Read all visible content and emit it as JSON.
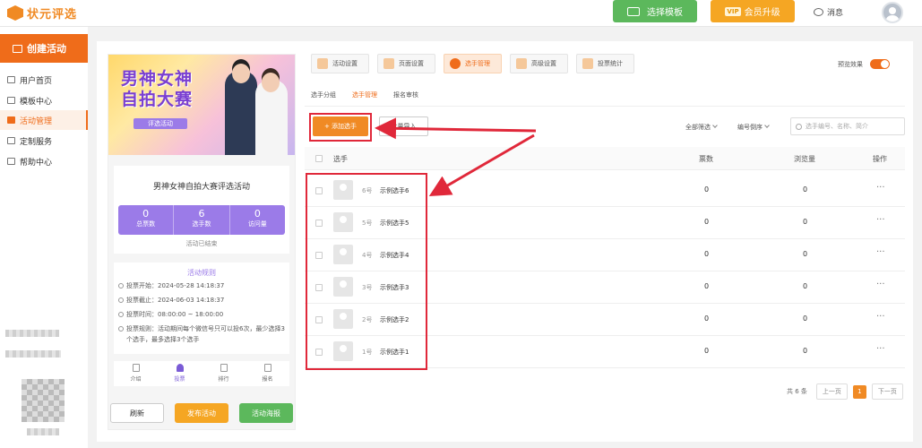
{
  "header": {
    "logo_text": "状元评选",
    "template_button": "选择模板",
    "vip_badge": "VIP",
    "vip_button": "会员升级",
    "messages": "消息"
  },
  "sidebar": {
    "create_button": "创建活动",
    "items": [
      {
        "label": "用户首页"
      },
      {
        "label": "模板中心"
      },
      {
        "label": "活动管理"
      },
      {
        "label": "定制服务"
      },
      {
        "label": "帮助中心"
      }
    ],
    "active_item": "活动管理"
  },
  "preview": {
    "banner_title_line1": "男神女神",
    "banner_title_line2": "自拍大赛",
    "banner_tag": "评选活动",
    "activity_title": "男神女神自拍大赛评选活动",
    "stats": [
      {
        "value": "0",
        "label": "总票数"
      },
      {
        "value": "6",
        "label": "选手数"
      },
      {
        "value": "0",
        "label": "访问量"
      }
    ],
    "status": "活动已结束",
    "rules_title": "活动规则",
    "rules": [
      "投票开始：2024-05-28 14:18:37",
      "投票截止：2024-06-03 14:18:37",
      "投票时间：08:00:00 ~ 18:00:00",
      "投票规则：活动期间每个微信号只可以投6次，最少选择3个选手，最多选择3个选手"
    ],
    "tabbar": [
      {
        "label": "介绍"
      },
      {
        "label": "投票"
      },
      {
        "label": "排行"
      },
      {
        "label": "报名"
      }
    ],
    "buttons": {
      "refresh": "刷新",
      "publish": "发布活动",
      "poster": "活动海报"
    }
  },
  "tabs": [
    {
      "label": "活动设置"
    },
    {
      "label": "页面设置"
    },
    {
      "label": "选手管理"
    },
    {
      "label": "高级设置"
    },
    {
      "label": "投票统计"
    }
  ],
  "active_tab": "选手管理",
  "preview_toggle_label": "预览效果",
  "subtabs": [
    {
      "label": "选手分组"
    },
    {
      "label": "选手管理"
    },
    {
      "label": "报名审核"
    }
  ],
  "toolbar": {
    "add_button": "+ 添加选手",
    "import_button": "批量导入",
    "filter_all": "全部筛选",
    "sort": "编号倒序",
    "search_placeholder": "选手编号、名称、简介"
  },
  "table": {
    "headers": {
      "contestant": "选手",
      "votes": "票数",
      "views": "浏览量",
      "actions": "操作"
    },
    "rows": [
      {
        "num": "6号",
        "name": "示例选手6",
        "votes": "0",
        "views": "0",
        "more": "···"
      },
      {
        "num": "5号",
        "name": "示例选手5",
        "votes": "0",
        "views": "0",
        "more": "···"
      },
      {
        "num": "4号",
        "name": "示例选手4",
        "votes": "0",
        "views": "0",
        "more": "···"
      },
      {
        "num": "3号",
        "name": "示例选手3",
        "votes": "0",
        "views": "0",
        "more": "···"
      },
      {
        "num": "2号",
        "name": "示例选手2",
        "votes": "0",
        "views": "0",
        "more": "···"
      },
      {
        "num": "1号",
        "name": "示例选手1",
        "votes": "0",
        "views": "0",
        "more": "···"
      }
    ]
  },
  "pagination": {
    "total": "共 6 条",
    "prev": "上一页",
    "current": "1",
    "next": "下一页"
  },
  "colors": {
    "accent": "#ef6c1a",
    "purple": "#9b7be8",
    "green": "#5cb85c",
    "highlight": "#e0283a"
  }
}
